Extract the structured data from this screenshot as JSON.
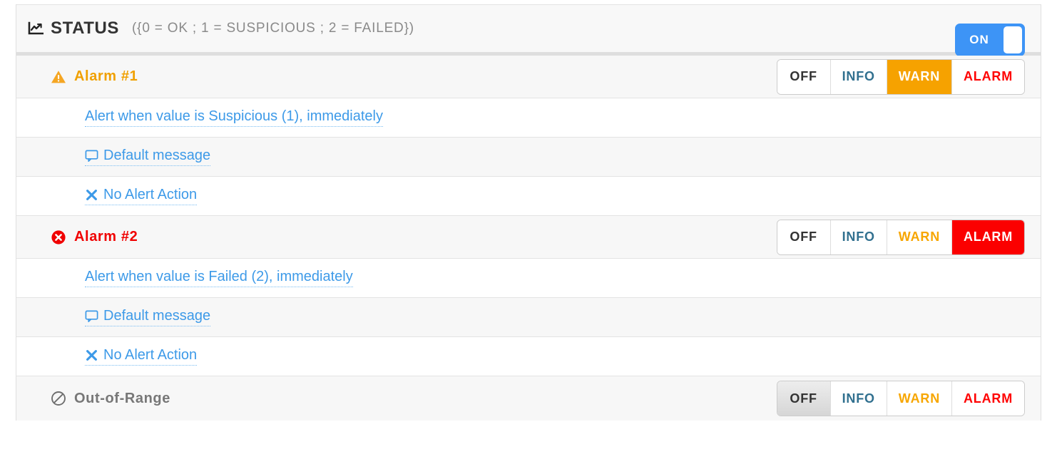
{
  "header": {
    "icon": "line-chart-icon",
    "title": "STATUS",
    "subtitle": "({0 = OK ; 1 = SUSPICIOUS ; 2 = FAILED})",
    "toggle": {
      "label": "ON",
      "state": "on",
      "color": "#3d94f6"
    }
  },
  "severity_options": {
    "off": "OFF",
    "info": "INFO",
    "warn": "WARN",
    "alarm": "ALARM"
  },
  "colors": {
    "warn": "#f6a200",
    "alarm": "#fb0000",
    "info": "#31708f",
    "off": "#333333",
    "link": "#3d9ae8",
    "muted": "#777777"
  },
  "sections": [
    {
      "icon": "warning-triangle-icon",
      "title": "Alarm #1",
      "active_severity": "warn",
      "rows": [
        {
          "icon": null,
          "text": "Alert when value is Suspicious (1), immediately"
        },
        {
          "icon": "comment-icon",
          "text": "Default message"
        },
        {
          "icon": "times-icon",
          "text": "No Alert Action"
        }
      ]
    },
    {
      "icon": "error-circle-icon",
      "title": "Alarm #2",
      "active_severity": "alarm",
      "rows": [
        {
          "icon": null,
          "text": "Alert when value is Failed (2), immediately"
        },
        {
          "icon": "comment-icon",
          "text": "Default message"
        },
        {
          "icon": "times-icon",
          "text": "No Alert Action"
        }
      ]
    },
    {
      "icon": "ban-icon",
      "title": "Out-of-Range",
      "active_severity": "off",
      "rows": []
    }
  ]
}
